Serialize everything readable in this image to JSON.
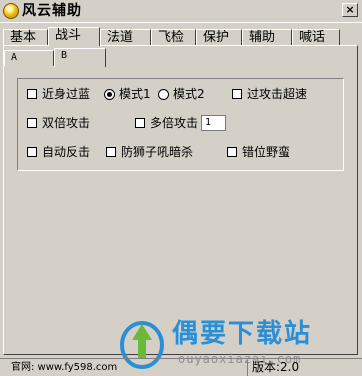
{
  "window": {
    "title": "风云辅助",
    "close_glyph": "×"
  },
  "tabs": [
    {
      "label": "基本"
    },
    {
      "label": "战斗"
    },
    {
      "label": "法道"
    },
    {
      "label": "飞检"
    },
    {
      "label": "保护"
    },
    {
      "label": "辅助"
    },
    {
      "label": "喊话"
    }
  ],
  "active_tab": "战斗",
  "subtabs": [
    {
      "label": "A"
    },
    {
      "label": "B"
    }
  ],
  "active_subtab": "B",
  "options": {
    "near_blue": {
      "label": "近身过蓝",
      "checked": false
    },
    "mode1": {
      "label": "模式1",
      "selected": true
    },
    "mode2": {
      "label": "模式2",
      "selected": false
    },
    "attack_speed": {
      "label": "过攻击超速",
      "checked": false
    },
    "double_attack": {
      "label": "双倍攻击",
      "checked": false
    },
    "multi_attack": {
      "label": "多倍攻击",
      "checked": false,
      "value": "1"
    },
    "auto_counter": {
      "label": "自动反击",
      "checked": false
    },
    "lion_roar": {
      "label": "防狮子吼暗杀",
      "checked": false
    },
    "misplace_barbarian": {
      "label": "错位野蛮",
      "checked": false
    }
  },
  "status": {
    "site": "官网: www.fy598.com",
    "version": "版本:2.0"
  },
  "watermark": {
    "name": "偶要下载站",
    "url": "ouyaoxiazai.com"
  }
}
